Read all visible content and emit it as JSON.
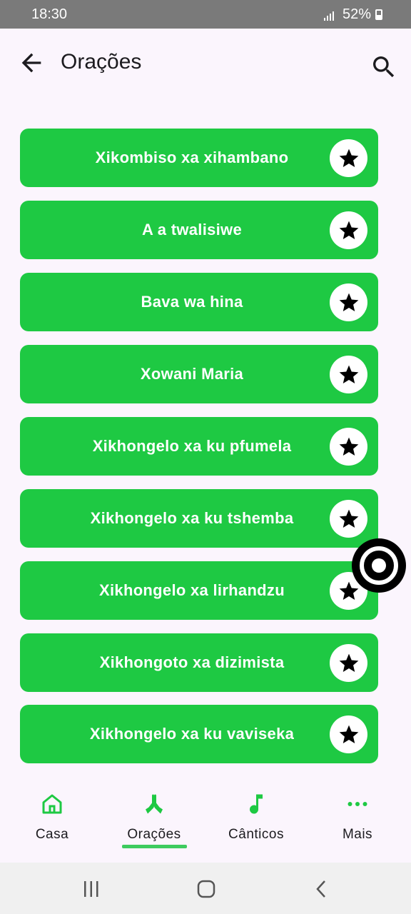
{
  "status_bar": {
    "time": "18:30",
    "battery": "52%"
  },
  "app_bar": {
    "title": "Orações"
  },
  "prayers": [
    {
      "label": "Xikombiso xa xihambano"
    },
    {
      "label": "A a twalisiwe"
    },
    {
      "label": "Bava wa hina"
    },
    {
      "label": "Xowani Maria"
    },
    {
      "label": "Xikhongelo xa ku pfumela"
    },
    {
      "label": "Xikhongelo xa ku tshemba"
    },
    {
      "label": "Xikhongelo xa lirhandzu"
    },
    {
      "label": "Xikhongoto xa dizimista"
    },
    {
      "label": "Xikhongelo xa ku vaviseka"
    }
  ],
  "bottom_nav": {
    "items": [
      {
        "label": "Casa",
        "icon": "home-icon"
      },
      {
        "label": "Orações",
        "icon": "praying-hands-icon",
        "selected": true
      },
      {
        "label": "Cânticos",
        "icon": "music-note-icon"
      },
      {
        "label": "Mais",
        "icon": "more-horizontal-icon"
      }
    ]
  },
  "colors": {
    "accent": "#1ec943",
    "background": "#fbf5fd",
    "indicator": "#3ecb5f"
  }
}
